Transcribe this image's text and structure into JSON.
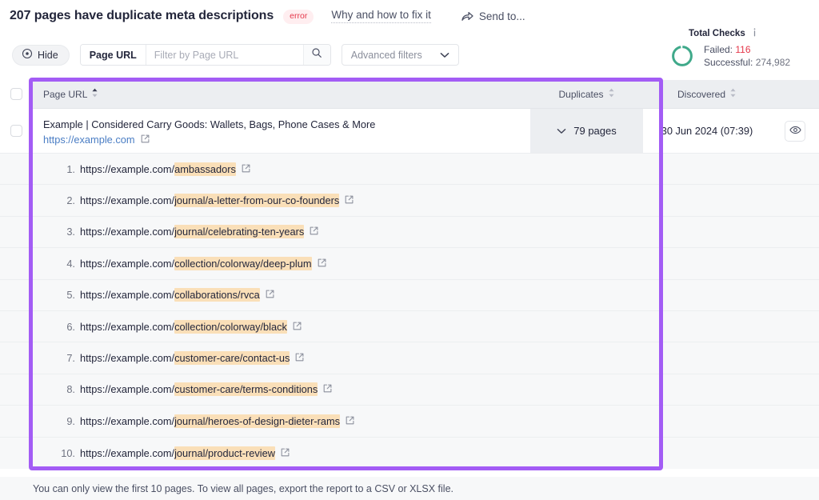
{
  "header": {
    "title": "207 pages have duplicate meta descriptions",
    "badge": "error",
    "fix_link": "Why and how to fix it",
    "send_to": "Send to...",
    "send_icon": "share-arrow-icon"
  },
  "filters": {
    "hide_label": "Hide",
    "hide_icon": "eye-icon",
    "search_label": "Page URL",
    "search_value": "",
    "search_placeholder": "Filter by Page URL",
    "search_icon": "search-icon",
    "advanced_label": "Advanced filters",
    "advanced_icon": "chevron-down-icon"
  },
  "total_checks": {
    "title": "Total Checks",
    "info_icon": "info-icon",
    "failed_label": "Failed:",
    "failed_value": "116",
    "successful_label": "Successful:",
    "successful_value": "274,982",
    "donut_color": "#3fa98a",
    "failed_color": "#e5374a"
  },
  "table": {
    "columns": {
      "page_url": "Page URL",
      "duplicates": "Duplicates",
      "discovered": "Discovered"
    },
    "sort_icon": "sort-arrows-icon",
    "row": {
      "title": "Example | Considered Carry Goods: Wallets, Bags, Phone Cases & More",
      "url": "https://example.com",
      "external_icon": "external-link-icon",
      "duplicates": "79 pages",
      "duplicates_icon": "chevron-down-icon",
      "discovered": "30 Jun 2024 (07:39)",
      "action_icon": "eye-icon"
    },
    "sublist": [
      {
        "n": "1.",
        "prefix": "https://example.com/",
        "highlight": "ambassadors"
      },
      {
        "n": "2.",
        "prefix": "https://example.com/",
        "highlight": "journal/a-letter-from-our-co-founders"
      },
      {
        "n": "3.",
        "prefix": "https://example.com/",
        "highlight": "journal/celebrating-ten-years"
      },
      {
        "n": "4.",
        "prefix": "https://example.com/",
        "highlight": "collection/colorway/deep-plum"
      },
      {
        "n": "5.",
        "prefix": "https://example.com/",
        "highlight": "collaborations/rvca"
      },
      {
        "n": "6.",
        "prefix": "https://example.com/",
        "highlight": "collection/colorway/black"
      },
      {
        "n": "7.",
        "prefix": "https://example.com/",
        "highlight": "customer-care/contact-us"
      },
      {
        "n": "8.",
        "prefix": "https://example.com/",
        "highlight": "customer-care/terms-conditions"
      },
      {
        "n": "9.",
        "prefix": "https://example.com/",
        "highlight": "journal/heroes-of-design-dieter-rams"
      },
      {
        "n": "10.",
        "prefix": "https://example.com/",
        "highlight": "journal/product-review"
      }
    ]
  },
  "footer": {
    "note": "You can only view the first 10 pages. To view all pages, export the report to a CSV or XLSX file."
  },
  "annotation": {
    "highlight_box_color": "#a35cf5",
    "url_highlight_color": "#fadfb8"
  }
}
